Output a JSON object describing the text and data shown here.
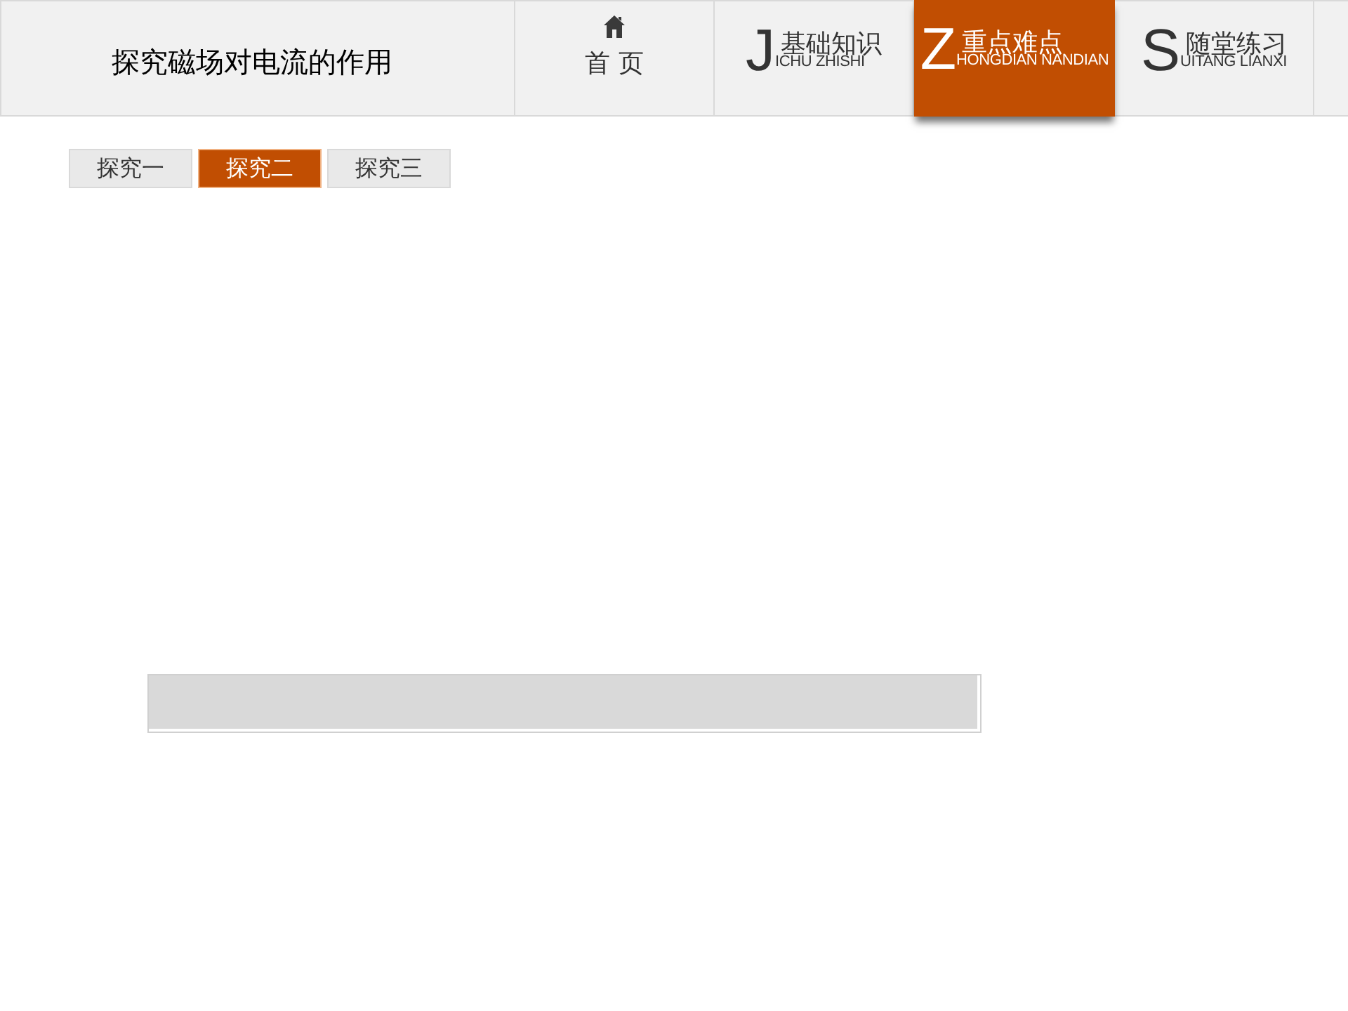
{
  "header": {
    "title": "探究磁场对电流的作用",
    "home": {
      "label": "首 页"
    },
    "tabs": [
      {
        "initial": "J",
        "title": "基础知识",
        "pinyin": "ICHU ZHISHI",
        "selected": false
      },
      {
        "initial": "Z",
        "title": "重点难点",
        "pinyin": "HONGDIAN NANDIAN",
        "selected": true
      },
      {
        "initial": "S",
        "title": "随堂练习",
        "pinyin": "UITANG LIANXI",
        "selected": false
      }
    ]
  },
  "sub_tabs": [
    {
      "label": "探究一",
      "selected": false
    },
    {
      "label": "探究二",
      "selected": true
    },
    {
      "label": "探究三",
      "selected": false
    }
  ]
}
